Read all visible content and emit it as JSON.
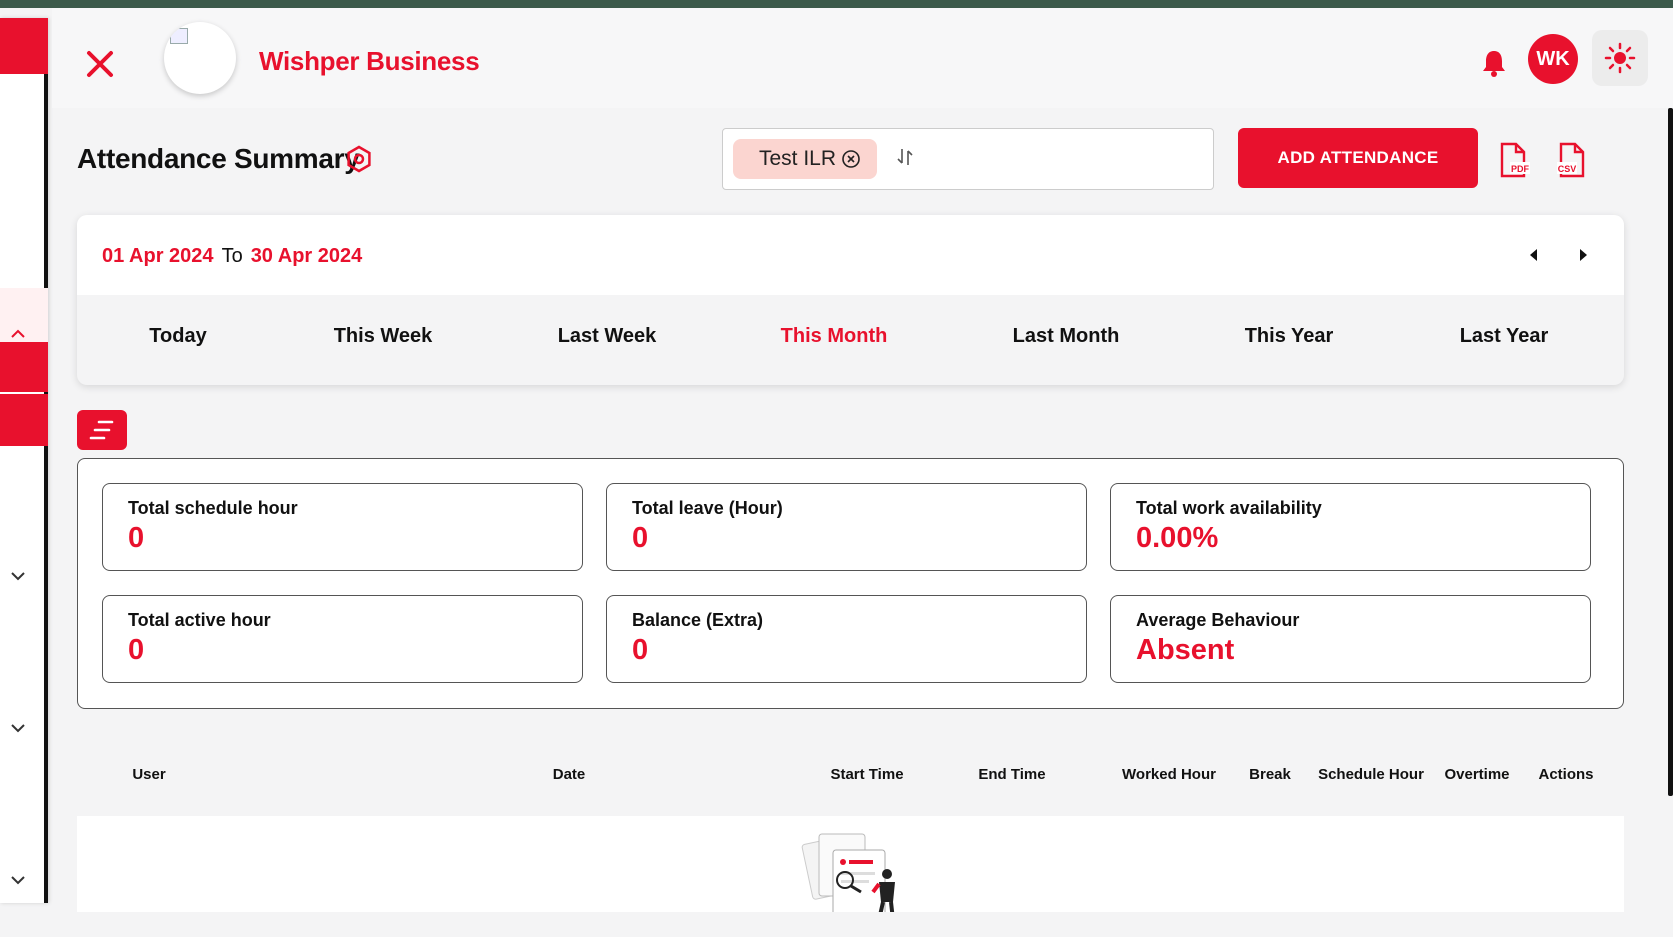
{
  "header": {
    "brand": "Wishper Business",
    "avatar_initials": "WK",
    "icons": [
      "close-icon",
      "bell-icon",
      "sun-icon"
    ]
  },
  "page": {
    "title": "Attendance Summary",
    "title_icon": "settings-hex-icon"
  },
  "filter": {
    "chip_label": "Test ILR"
  },
  "actions": {
    "add_label": "ADD ATTENDANCE",
    "pdf_label": "PDF",
    "csv_label": "CSV"
  },
  "date": {
    "from": "01 Apr 2024",
    "to_word": "To",
    "to": "30 Apr 2024"
  },
  "periods": [
    {
      "label": "Today",
      "active": false
    },
    {
      "label": "This Week",
      "active": false
    },
    {
      "label": "Last Week",
      "active": false
    },
    {
      "label": "This Month",
      "active": true
    },
    {
      "label": "Last Month",
      "active": false
    },
    {
      "label": "This Year",
      "active": false
    },
    {
      "label": "Last Year",
      "active": false
    }
  ],
  "stats": [
    {
      "label": "Total schedule hour",
      "value": "0"
    },
    {
      "label": "Total leave (Hour)",
      "value": "0"
    },
    {
      "label": "Total work availability",
      "value": "0.00%"
    },
    {
      "label": "Total active hour",
      "value": "0"
    },
    {
      "label": "Balance (Extra)",
      "value": "0"
    },
    {
      "label": "Average Behaviour",
      "value": "Absent"
    }
  ],
  "table": {
    "columns": [
      "User",
      "Date",
      "Start Time",
      "End Time",
      "Worked Hour",
      "Break",
      "Schedule Hour",
      "Overtime",
      "Actions"
    ]
  },
  "colors": {
    "accent": "#e8112d",
    "chip_bg": "#fbd5d0",
    "top_strip": "#3c5a4b"
  }
}
